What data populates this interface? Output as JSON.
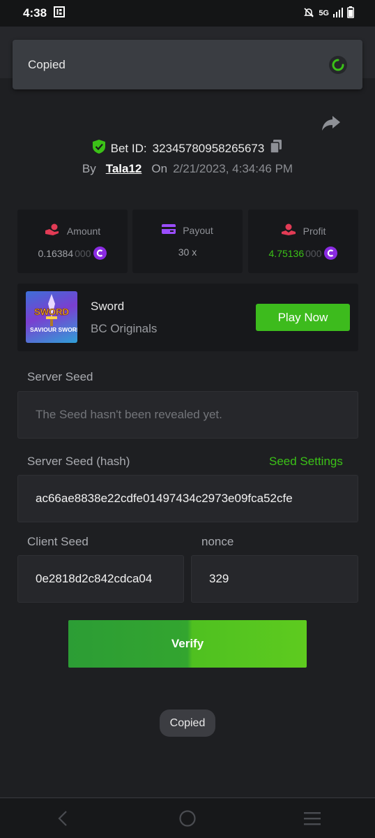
{
  "status_bar": {
    "time": "4:38",
    "network": "5G"
  },
  "toast_top": {
    "text": "Copied"
  },
  "bet": {
    "id_label": "Bet ID:",
    "id_value": "32345780958265673",
    "by_label": "By",
    "user": "Tala12",
    "on_label": "On",
    "datetime": "2/21/2023, 4:34:46 PM"
  },
  "stats": [
    {
      "label": "Amount",
      "value_main": "0.16384",
      "value_dim": "000",
      "icon": "bet-hand-icon"
    },
    {
      "label": "Payout",
      "value_main": "30 x",
      "value_dim": "",
      "icon": "wallet-icon"
    },
    {
      "label": "Profit",
      "value_main": "4.75136",
      "value_dim": "000",
      "icon": "profit-hand-icon"
    }
  ],
  "game": {
    "name": "Sword",
    "provider": "BC Originals",
    "play_label": "Play Now",
    "thumb_text_top": "SWORD",
    "thumb_text_bottom": "SAVIOUR SWORD"
  },
  "server_seed": {
    "label": "Server Seed",
    "value": "The Seed hasn't been revealed yet."
  },
  "server_seed_hash": {
    "label": "Server Seed (hash)",
    "settings_link": "Seed Settings",
    "value": "ac66ae8838e22cdfe01497434c2973e09fca52cfe"
  },
  "client_seed": {
    "label": "Client Seed",
    "value": "0e2818d2c842cdca04"
  },
  "nonce": {
    "label": "nonce",
    "value": "329"
  },
  "verify_label": "Verify",
  "toast_bottom": {
    "text": "Copied"
  },
  "colors": {
    "accent_green": "#3bc117",
    "coin_purple": "#8a2be2",
    "background": "#1e1f22"
  }
}
